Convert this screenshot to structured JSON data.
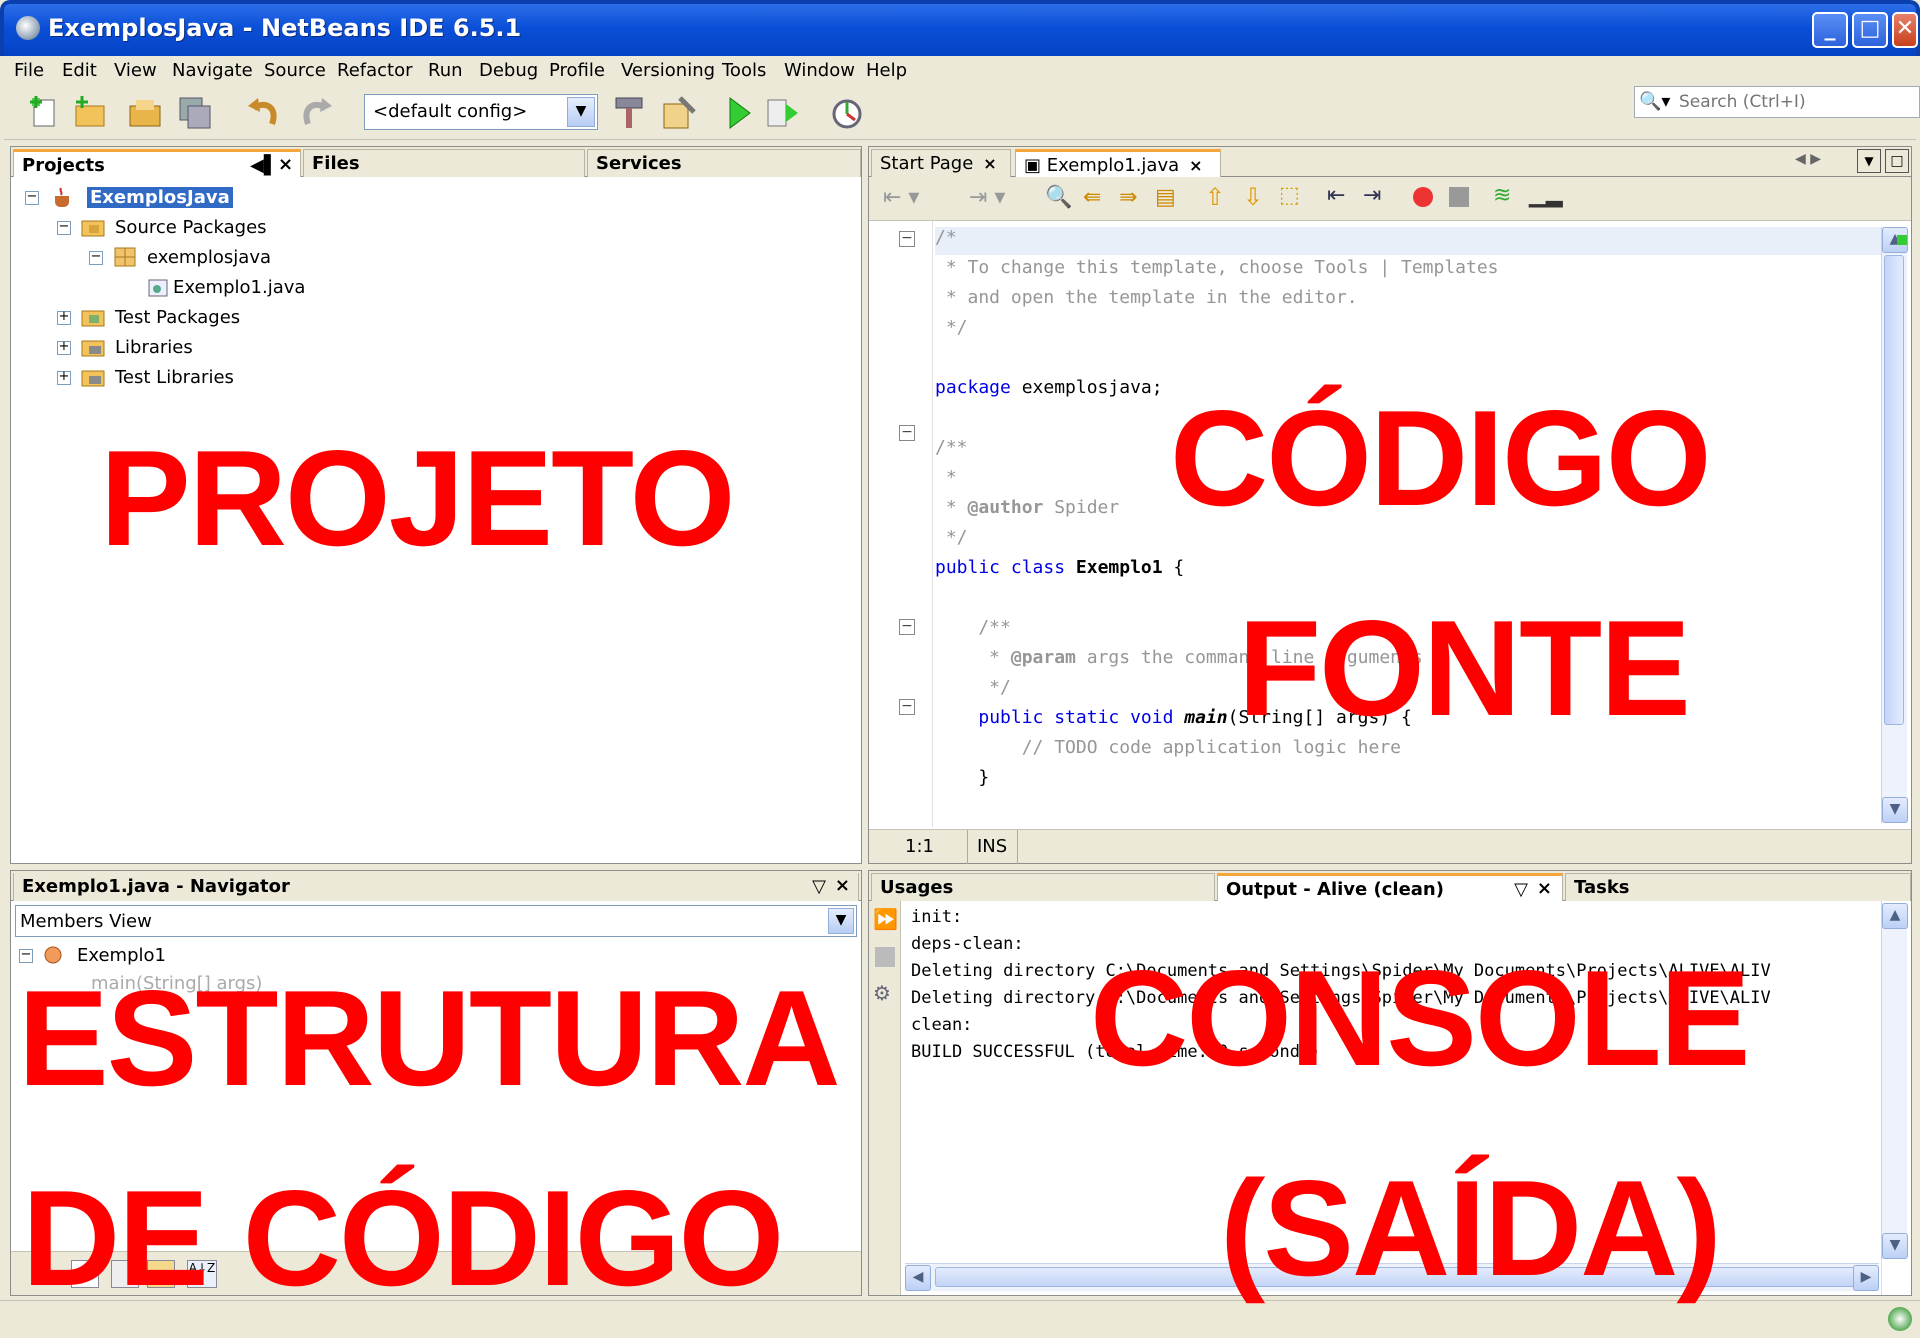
{
  "window": {
    "title": "ExemplosJava - NetBeans IDE 6.5.1",
    "controls": [
      "_",
      "□",
      "✕"
    ]
  },
  "menu": [
    "File",
    "Edit",
    "View",
    "Navigate",
    "Source",
    "Refactor",
    "Run",
    "Debug",
    "Profile",
    "Versioning",
    "Tools",
    "Window",
    "Help"
  ],
  "toolbar": {
    "config_value": "<default config>",
    "search_placeholder": "Search (Ctrl+I)",
    "icons": [
      "new-file-icon",
      "new-project-icon",
      "open-project-icon",
      "save-all-icon",
      "undo-icon",
      "redo-icon",
      "build-icon",
      "clean-build-icon",
      "run-icon",
      "debug-icon",
      "profile-icon"
    ]
  },
  "projects_panel": {
    "tabs": [
      "Projects",
      "Files",
      "Services"
    ],
    "tree": [
      {
        "label": "ExemplosJava",
        "icon": "java-project-icon"
      },
      {
        "label": "Source Packages",
        "icon": "source-folder-icon"
      },
      {
        "label": "exemplosjava",
        "icon": "package-icon"
      },
      {
        "label": "Exemplo1.java",
        "icon": "java-class-icon"
      },
      {
        "label": "Test Packages",
        "icon": "test-folder-icon"
      },
      {
        "label": "Libraries",
        "icon": "library-folder-icon"
      },
      {
        "label": "Test Libraries",
        "icon": "library-folder-icon"
      }
    ]
  },
  "editor": {
    "tabs": [
      "Start Page",
      "Exemplo1.java"
    ],
    "status": {
      "position": "1:1",
      "mode": "INS"
    },
    "lines": [
      "/*",
      " * To change this template, choose Tools | Templates",
      " * and open the template in the editor.",
      " */",
      "",
      "package exemplosjava;",
      "",
      "/**",
      " *",
      " * @author Spider",
      " */",
      "public class Exemplo1 {",
      "",
      "    /**",
      "     * @param args the command line arguments",
      "     */",
      "    public static void main(String[] args) {",
      "        // TODO code application logic here",
      "    }"
    ]
  },
  "navigator": {
    "title": "Exemplo1.java - Navigator",
    "view": "Members View",
    "root": "Exemplo1",
    "member": "main(String[] args)"
  },
  "output": {
    "tabs": [
      "Usages",
      "Output - Alive (clean)",
      "Tasks"
    ],
    "lines": [
      "init:",
      "deps-clean:",
      "Deleting directory C:\\Documents and Settings\\Spider\\My Documents\\Projects\\ALIVE\\ALIV",
      "Deleting directory C:\\Documents and Settings\\Spider\\My Documents\\Projects\\ALIVE\\ALIV",
      "clean:",
      "BUILD SUCCESSFUL (total time: 0 seconds)"
    ]
  },
  "overlays": {
    "projeto": "PROJETO",
    "codigo_fonte": [
      "CÓDIGO",
      "FONTE"
    ],
    "estrutura": [
      "ESTRUTURA",
      "DE CÓDIGO"
    ],
    "console": [
      "CONSOLE",
      "(SAÍDA)"
    ]
  },
  "colors": {
    "overlay": "#ff0000",
    "titlebar": "#0a4fd8",
    "keyword": "#0000e6",
    "comment": "#969696",
    "selection": "#316ac5"
  }
}
